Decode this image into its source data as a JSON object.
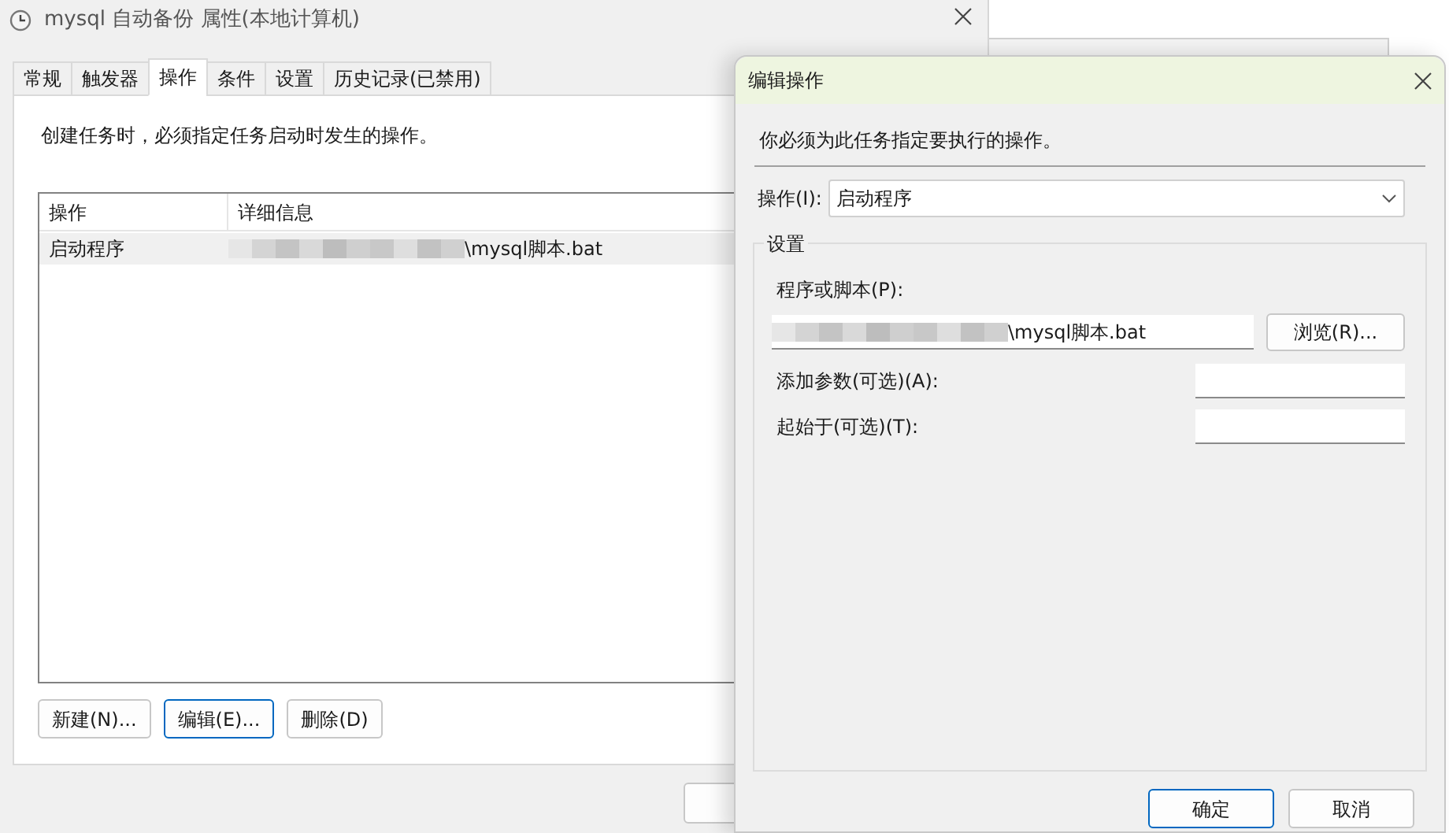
{
  "main_window": {
    "title": "mysql 自动备份 属性(本地计算机)",
    "tabs": [
      {
        "label": "常规",
        "selected": false
      },
      {
        "label": "触发器",
        "selected": false
      },
      {
        "label": "操作",
        "selected": true
      },
      {
        "label": "条件",
        "selected": false
      },
      {
        "label": "设置",
        "selected": false
      },
      {
        "label": "历史记录(已禁用)",
        "selected": false
      }
    ],
    "description": "创建任务时，必须指定任务启动时发生的操作。",
    "table": {
      "columns": [
        "操作",
        "详细信息"
      ],
      "rows": [
        {
          "cells": [
            "启动程序",
            "\\mysql脚本.bat"
          ],
          "selected": true
        }
      ]
    },
    "buttons": [
      {
        "label": "新建(N)...",
        "focused": false
      },
      {
        "label": "编辑(E)...",
        "focused": true
      },
      {
        "label": "删除(D)",
        "focused": false
      }
    ]
  },
  "dialog": {
    "title": "编辑操作",
    "instruction": "你必须为此任务指定要执行的操作。",
    "action": {
      "label": "操作(I):",
      "value": "启动程序"
    },
    "group_label": "设置",
    "program": {
      "label": "程序或脚本(P):",
      "value": "\\mysql脚本.bat"
    },
    "browse_button": "浏览(R)...",
    "fields": [
      {
        "label": "添加参数(可选)(A):"
      },
      {
        "label": "起始于(可选)(T):"
      }
    ],
    "buttons": [
      {
        "label": "确定",
        "focused": true
      },
      {
        "label": "取消",
        "focused": false
      }
    ]
  }
}
